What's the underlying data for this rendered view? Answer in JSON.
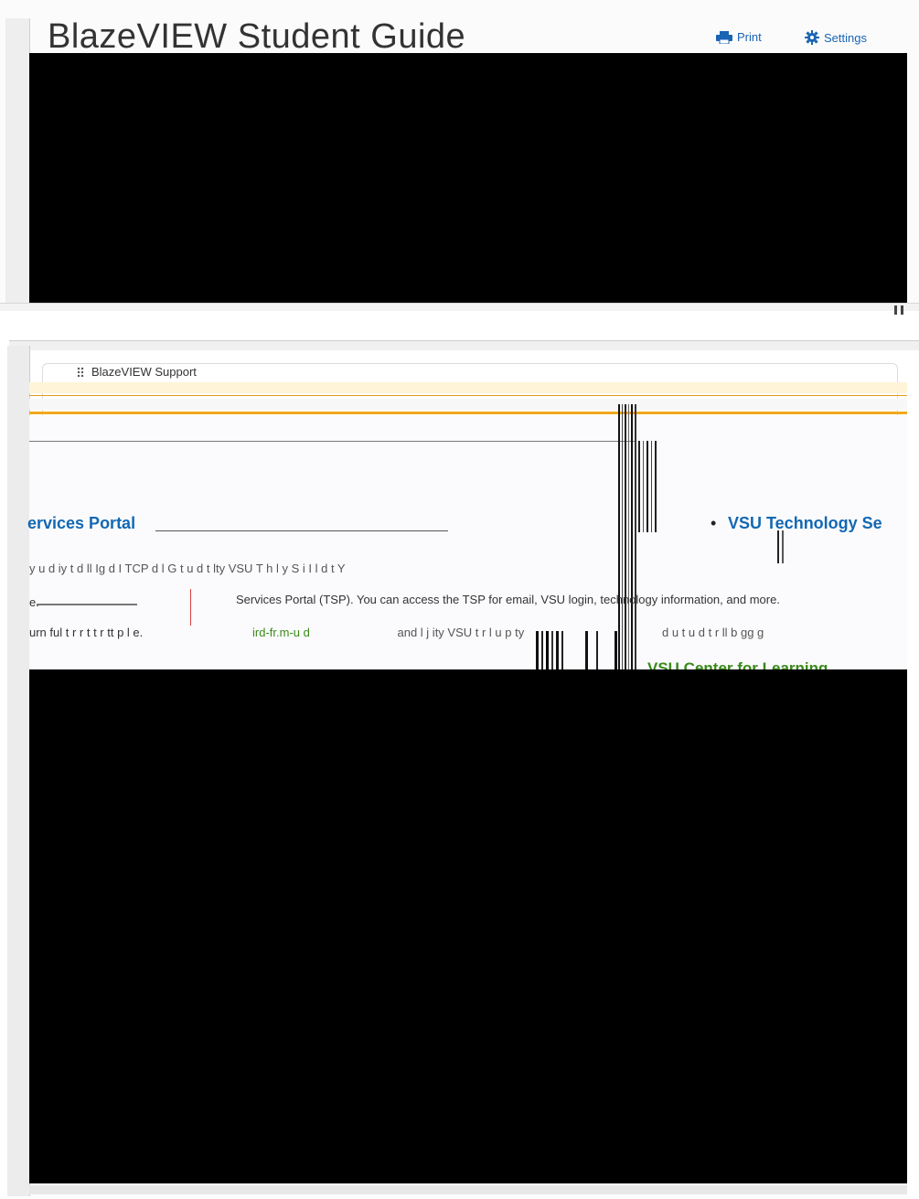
{
  "header": {
    "title": "BlazeVIEW Student Guide",
    "print_label": "Print",
    "settings_label": "Settings"
  },
  "support_widget": {
    "title": "BlazeVIEW Support"
  },
  "content": {
    "portal_title": "ervices Portal",
    "tech_bullet": "•",
    "tech_title": "VSU Technology Se",
    "line1": "y u d  iy t  d  ll    Ig d I  TCP  d  l  G   t u  d  t    lty  VSU T  h  l  y S   i   I    l  d  t  Y",
    "line2a": "e.",
    "line2b": "Services Portal (TSP). You can access the TSP for email, VSU login, technology information, and more.",
    "line3a": "urn  ful   t  r  r  t  t r  tt   p  l  e.",
    "line3_link": "ird-fr.m-u d",
    "line3b": "and l  j   ity   VSU   t  r  l  u  p   ty",
    "line3c": "d u   t u  d  t  r  ll  b  gg  g",
    "green_heading": "VSU Center for Learning"
  },
  "colors": {
    "link_blue": "#1268b3",
    "accent_orange": "#f2a91e",
    "link_green": "#3a8a1a",
    "redaction": "#000000"
  },
  "icons": [
    "printer-icon",
    "gear-icon",
    "drag-handle-icon"
  ]
}
